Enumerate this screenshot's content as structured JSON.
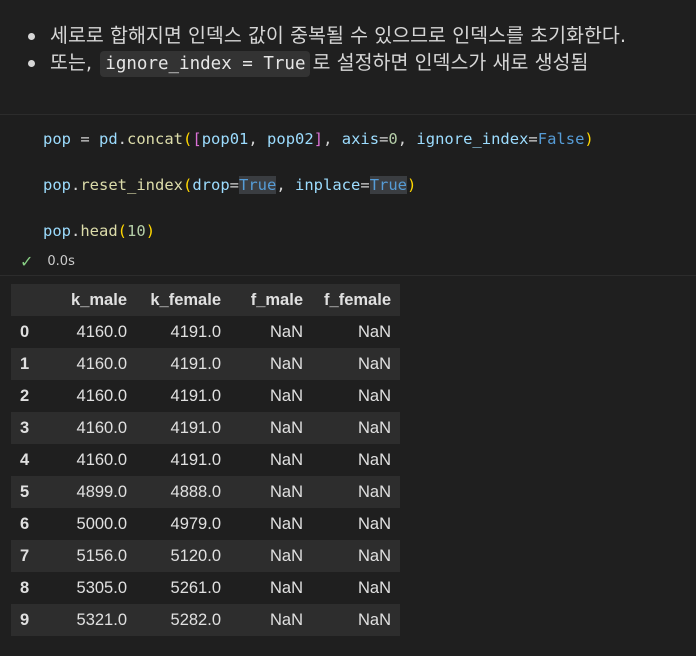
{
  "markdown": {
    "bullet1": "세로로 합해지면 인덱스 값이 중복될 수 있으므로 인덱스를 초기화한다.",
    "bullet2_prefix": "또는,",
    "bullet2_code": "ignore_index = True",
    "bullet2_suffix": "로 설정하면 인덱스가 새로 생성됨"
  },
  "code": {
    "line1": {
      "var": "pop",
      "eq": " = ",
      "mod": "pd",
      "dot": ".",
      "fn": "concat",
      "open": "(",
      "lb": "[",
      "a1": "pop01",
      "comma1": ", ",
      "a2": "pop02",
      "rb": "]",
      "comma2": ", ",
      "kw1": "axis",
      "eq1": "=",
      "val1": "0",
      "comma3": ", ",
      "kw2": "ignore_index",
      "eq2": "=",
      "val2": "False",
      "close": ")"
    },
    "line2": {
      "var": "pop",
      "dot": ".",
      "fn": "reset_index",
      "open": "(",
      "kw1": "drop",
      "eq1": "=",
      "val1": "True",
      "comma": ", ",
      "kw2": "inplace",
      "eq2": "=",
      "val2": "True",
      "close": ")"
    },
    "line3": {
      "var": "pop",
      "dot": ".",
      "fn": "head",
      "open": "(",
      "arg": "10",
      "close": ")"
    }
  },
  "status": {
    "check": "✓",
    "time": "0.0s"
  },
  "table": {
    "columns": [
      "",
      "k_male",
      "k_female",
      "f_male",
      "f_female"
    ],
    "rows": [
      [
        "0",
        "4160.0",
        "4191.0",
        "NaN",
        "NaN"
      ],
      [
        "1",
        "4160.0",
        "4191.0",
        "NaN",
        "NaN"
      ],
      [
        "2",
        "4160.0",
        "4191.0",
        "NaN",
        "NaN"
      ],
      [
        "3",
        "4160.0",
        "4191.0",
        "NaN",
        "NaN"
      ],
      [
        "4",
        "4160.0",
        "4191.0",
        "NaN",
        "NaN"
      ],
      [
        "5",
        "4899.0",
        "4888.0",
        "NaN",
        "NaN"
      ],
      [
        "6",
        "5000.0",
        "4979.0",
        "NaN",
        "NaN"
      ],
      [
        "7",
        "5156.0",
        "5120.0",
        "NaN",
        "NaN"
      ],
      [
        "8",
        "5305.0",
        "5261.0",
        "NaN",
        "NaN"
      ],
      [
        "9",
        "5321.0",
        "5282.0",
        "NaN",
        "NaN"
      ]
    ]
  }
}
